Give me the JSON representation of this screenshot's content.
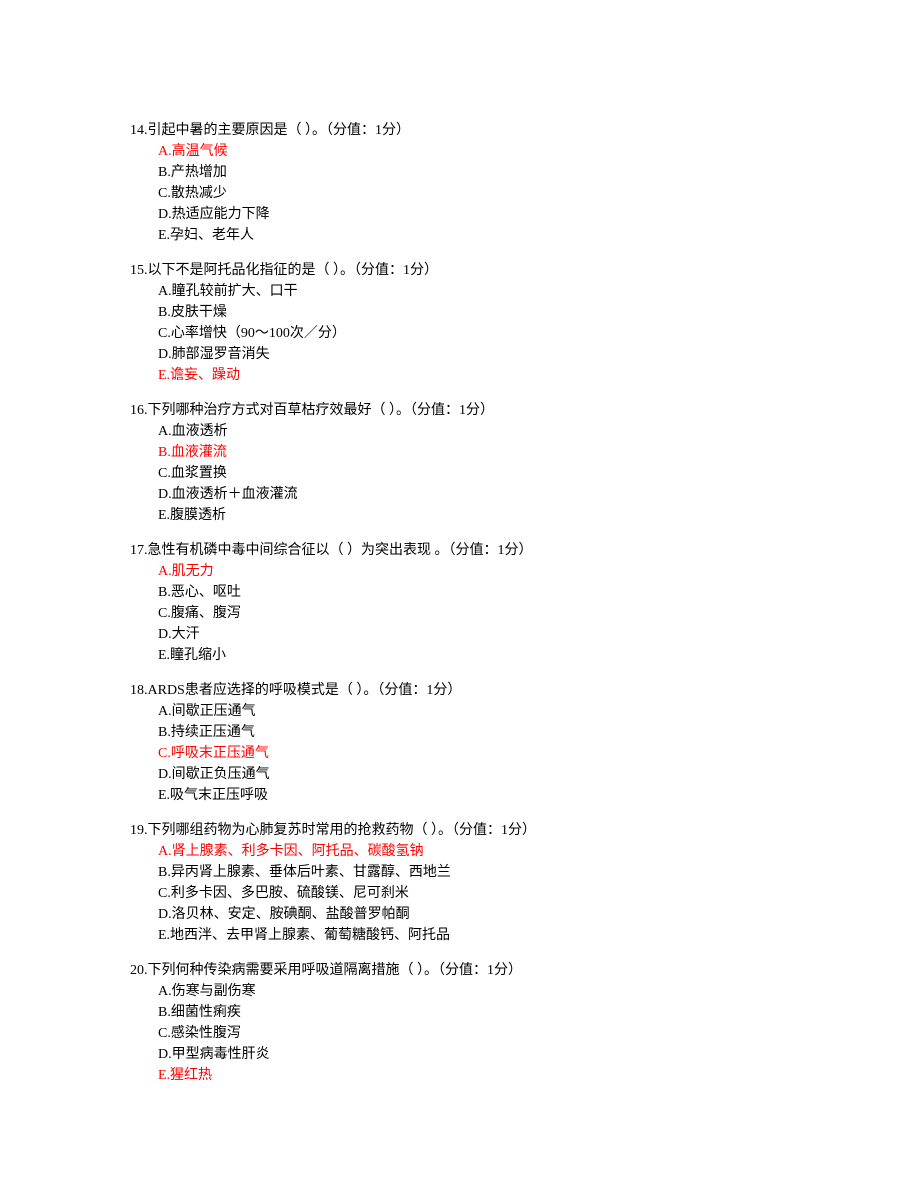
{
  "questions": [
    {
      "num": "14",
      "stem": "引起中暑的主要原因是（  ）。（分值：1分）",
      "options": [
        {
          "label": "A.高温气候",
          "correct": true
        },
        {
          "label": "B.产热增加",
          "correct": false
        },
        {
          "label": "C.散热减少",
          "correct": false
        },
        {
          "label": "D.热适应能力下降",
          "correct": false
        },
        {
          "label": "E.孕妇、老年人",
          "correct": false
        }
      ]
    },
    {
      "num": "15",
      "stem": "以下不是阿托品化指征的是（  ）。（分值：1分）",
      "options": [
        {
          "label": "A.瞳孔较前扩大、口干",
          "correct": false
        },
        {
          "label": "B.皮肤干燥",
          "correct": false
        },
        {
          "label": "C.心率增快（90～100次／分）",
          "correct": false
        },
        {
          "label": "D.肺部湿罗音消失",
          "correct": false
        },
        {
          "label": "E.谵妄、躁动",
          "correct": true
        }
      ]
    },
    {
      "num": "16",
      "stem": "下列哪种治疗方式对百草枯疗效最好（  ）。（分值：1分）",
      "options": [
        {
          "label": "A.血液透析",
          "correct": false
        },
        {
          "label": "B.血液灌流",
          "correct": true
        },
        {
          "label": "C.血浆置换",
          "correct": false
        },
        {
          "label": "D.血液透析＋血液灌流",
          "correct": false
        },
        {
          "label": "E.腹膜透析",
          "correct": false
        }
      ]
    },
    {
      "num": "17",
      "stem": "急性有机磷中毒中间综合征以（  ）为突出表现 。（分值：1分）",
      "options": [
        {
          "label": "A.肌无力",
          "correct": true
        },
        {
          "label": "B.恶心、呕吐",
          "correct": false
        },
        {
          "label": "C.腹痛、腹泻",
          "correct": false
        },
        {
          "label": "D.大汗",
          "correct": false
        },
        {
          "label": "E.瞳孔缩小",
          "correct": false
        }
      ]
    },
    {
      "num": "18",
      "stem": "ARDS患者应选择的呼吸模式是（  ）。（分值：1分）",
      "options": [
        {
          "label": "A.间歇正压通气",
          "correct": false
        },
        {
          "label": "B.持续正压通气",
          "correct": false
        },
        {
          "label": "C.呼吸末正压通气",
          "correct": true
        },
        {
          "label": "D.间歇正负压通气",
          "correct": false
        },
        {
          "label": "E.吸气末正压呼吸",
          "correct": false
        }
      ]
    },
    {
      "num": "19",
      "stem": "下列哪组药物为心肺复苏时常用的抢救药物（  ）。（分值：1分）",
      "options": [
        {
          "label": "A.肾上腺素、利多卡因、阿托品、碳酸氢钠",
          "correct": true
        },
        {
          "label": "B.异丙肾上腺素、垂体后叶素、甘露醇、西地兰",
          "correct": false
        },
        {
          "label": "C.利多卡因、多巴胺、硫酸镁、尼可刹米",
          "correct": false
        },
        {
          "label": "D.洛贝林、安定、胺碘酮、盐酸普罗帕酮",
          "correct": false
        },
        {
          "label": "E.地西泮、去甲肾上腺素、葡萄糖酸钙、阿托品",
          "correct": false
        }
      ]
    },
    {
      "num": "20",
      "stem": "下列何种传染病需要采用呼吸道隔离措施（  ）。（分值：1分）",
      "options": [
        {
          "label": "A.伤寒与副伤寒",
          "correct": false
        },
        {
          "label": "B.细菌性痢疾",
          "correct": false
        },
        {
          "label": "C.感染性腹泻",
          "correct": false
        },
        {
          "label": "D.甲型病毒性肝炎",
          "correct": false
        },
        {
          "label": "E.猩红热",
          "correct": true
        }
      ]
    }
  ]
}
